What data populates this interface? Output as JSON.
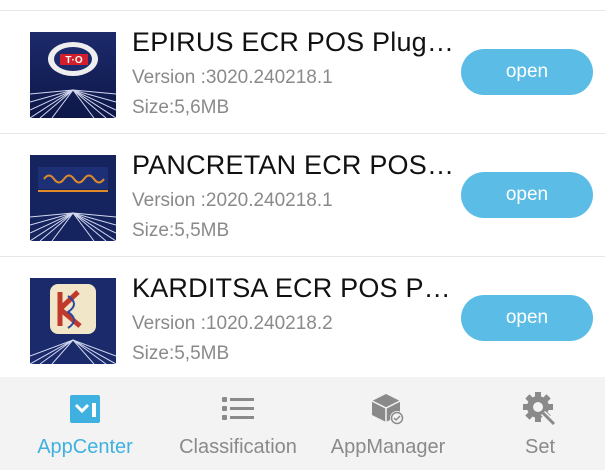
{
  "apps": [
    {
      "name": "EPIRUS ECR POS Plug…",
      "version": "Version :3020.240218.1",
      "size": "Size:5,6MB",
      "button": "open"
    },
    {
      "name": "PANCRETAN ECR POS…",
      "version": "Version :2020.240218.1",
      "size": "Size:5,5MB",
      "button": "open"
    },
    {
      "name": "KARDITSA ECR POS P…",
      "version": "Version :1020.240218.2",
      "size": "Size:5,5MB",
      "button": "open"
    }
  ],
  "tabs": [
    {
      "label": "AppCenter",
      "icon": "app-center-icon",
      "active": true
    },
    {
      "label": "Classification",
      "icon": "list-icon",
      "active": false
    },
    {
      "label": "AppManager",
      "icon": "package-icon",
      "active": false
    },
    {
      "label": "Set",
      "icon": "settings-icon",
      "active": false
    }
  ],
  "colors": {
    "accent": "#5bbde6",
    "active_tab": "#3fb1e0",
    "inactive": "#8a8a8a",
    "tabbar_bg": "#f3f3f3"
  }
}
